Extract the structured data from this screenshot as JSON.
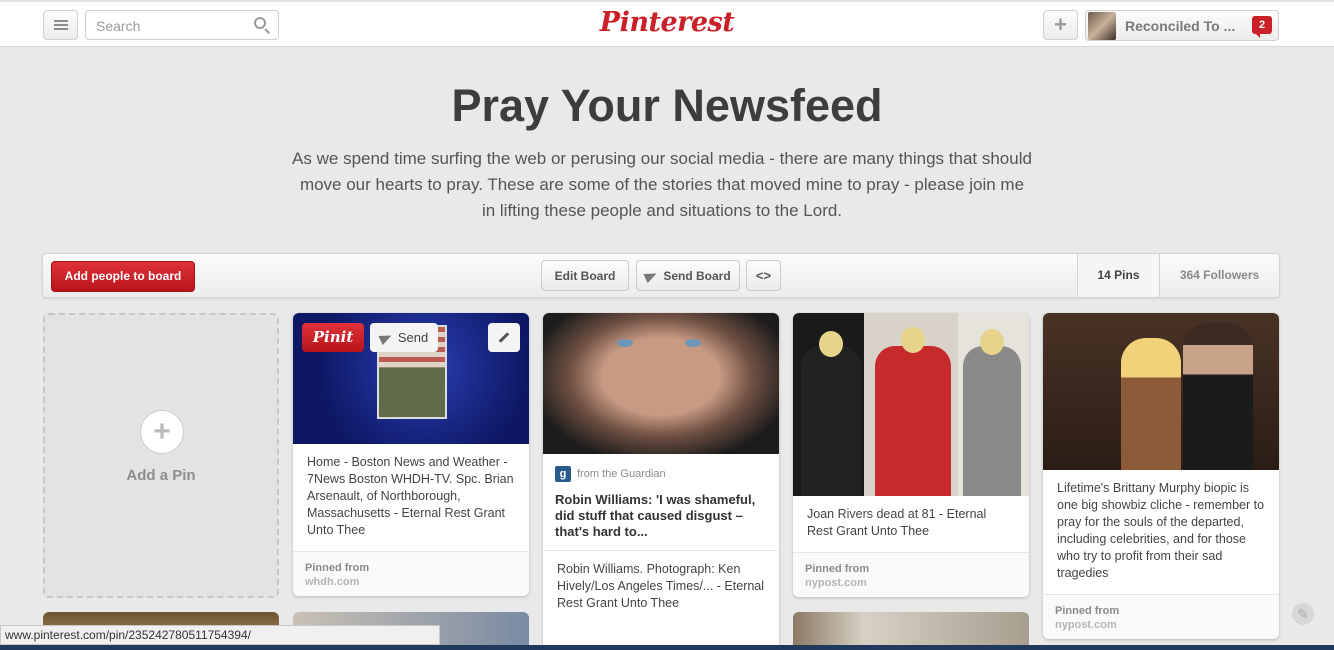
{
  "header": {
    "search_placeholder": "Search",
    "logo": "Pinterest",
    "add_label": "+",
    "user_name": "Reconciled To ...",
    "notification_count": "2"
  },
  "board": {
    "title": "Pray Your Newsfeed",
    "description": "As we spend time surfing the web or perusing our social media - there are many things that should move our hearts to pray. These are some of the stories that moved mine to pray - please join me in lifting these people and situations to the Lord."
  },
  "toolbar": {
    "add_people": "Add people to board",
    "edit_board": "Edit Board",
    "send_board": "Send Board",
    "embed": "<>",
    "pins": "14 Pins",
    "followers": "364 Followers"
  },
  "add_pin": {
    "icon": "+",
    "label": "Add a Pin"
  },
  "pins": [
    {
      "pinit": "Pinit",
      "send": "Send",
      "description": "Home - Boston News and Weather - 7News Boston WHDH-TV. Spc. Brian Arsenault, of Northborough, Massachusetts - Eternal Rest Grant Unto Thee",
      "pinned_from": "Pinned from",
      "domain": "whdh.com"
    },
    {
      "source_icon": "g",
      "source": "from the Guardian",
      "headline": "Robin Williams: 'I was shameful, did stuff that caused disgust – that's hard to...",
      "description": "Robin Williams. Photograph: Ken Hively/Los Angeles Times/... - Eternal Rest Grant Unto Thee"
    },
    {
      "description": "Joan Rivers dead at 81 - Eternal Rest Grant Unto Thee",
      "pinned_from": "Pinned from",
      "domain": "nypost.com"
    },
    {
      "description": "Lifetime's Brittany Murphy biopic is one big showbiz cliche - remember to pray for the souls of the departed, including celebrities, and for those who try to profit from their sad tragedies",
      "pinned_from": "Pinned from",
      "domain": "nypost.com"
    }
  ],
  "status_url": "www.pinterest.com/pin/235242780511754394/"
}
